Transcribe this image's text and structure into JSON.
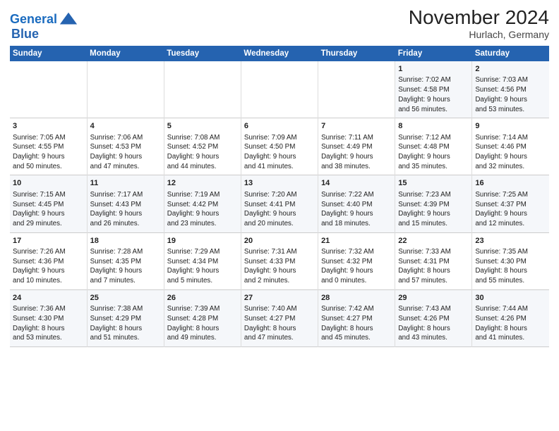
{
  "header": {
    "logo_line1": "General",
    "logo_line2": "Blue",
    "title": "November 2024",
    "location": "Hurlach, Germany"
  },
  "weekdays": [
    "Sunday",
    "Monday",
    "Tuesday",
    "Wednesday",
    "Thursday",
    "Friday",
    "Saturday"
  ],
  "weeks": [
    [
      {
        "day": "",
        "content": ""
      },
      {
        "day": "",
        "content": ""
      },
      {
        "day": "",
        "content": ""
      },
      {
        "day": "",
        "content": ""
      },
      {
        "day": "",
        "content": ""
      },
      {
        "day": "1",
        "content": "Sunrise: 7:02 AM\nSunset: 4:58 PM\nDaylight: 9 hours\nand 56 minutes."
      },
      {
        "day": "2",
        "content": "Sunrise: 7:03 AM\nSunset: 4:56 PM\nDaylight: 9 hours\nand 53 minutes."
      }
    ],
    [
      {
        "day": "3",
        "content": "Sunrise: 7:05 AM\nSunset: 4:55 PM\nDaylight: 9 hours\nand 50 minutes."
      },
      {
        "day": "4",
        "content": "Sunrise: 7:06 AM\nSunset: 4:53 PM\nDaylight: 9 hours\nand 47 minutes."
      },
      {
        "day": "5",
        "content": "Sunrise: 7:08 AM\nSunset: 4:52 PM\nDaylight: 9 hours\nand 44 minutes."
      },
      {
        "day": "6",
        "content": "Sunrise: 7:09 AM\nSunset: 4:50 PM\nDaylight: 9 hours\nand 41 minutes."
      },
      {
        "day": "7",
        "content": "Sunrise: 7:11 AM\nSunset: 4:49 PM\nDaylight: 9 hours\nand 38 minutes."
      },
      {
        "day": "8",
        "content": "Sunrise: 7:12 AM\nSunset: 4:48 PM\nDaylight: 9 hours\nand 35 minutes."
      },
      {
        "day": "9",
        "content": "Sunrise: 7:14 AM\nSunset: 4:46 PM\nDaylight: 9 hours\nand 32 minutes."
      }
    ],
    [
      {
        "day": "10",
        "content": "Sunrise: 7:15 AM\nSunset: 4:45 PM\nDaylight: 9 hours\nand 29 minutes."
      },
      {
        "day": "11",
        "content": "Sunrise: 7:17 AM\nSunset: 4:43 PM\nDaylight: 9 hours\nand 26 minutes."
      },
      {
        "day": "12",
        "content": "Sunrise: 7:19 AM\nSunset: 4:42 PM\nDaylight: 9 hours\nand 23 minutes."
      },
      {
        "day": "13",
        "content": "Sunrise: 7:20 AM\nSunset: 4:41 PM\nDaylight: 9 hours\nand 20 minutes."
      },
      {
        "day": "14",
        "content": "Sunrise: 7:22 AM\nSunset: 4:40 PM\nDaylight: 9 hours\nand 18 minutes."
      },
      {
        "day": "15",
        "content": "Sunrise: 7:23 AM\nSunset: 4:39 PM\nDaylight: 9 hours\nand 15 minutes."
      },
      {
        "day": "16",
        "content": "Sunrise: 7:25 AM\nSunset: 4:37 PM\nDaylight: 9 hours\nand 12 minutes."
      }
    ],
    [
      {
        "day": "17",
        "content": "Sunrise: 7:26 AM\nSunset: 4:36 PM\nDaylight: 9 hours\nand 10 minutes."
      },
      {
        "day": "18",
        "content": "Sunrise: 7:28 AM\nSunset: 4:35 PM\nDaylight: 9 hours\nand 7 minutes."
      },
      {
        "day": "19",
        "content": "Sunrise: 7:29 AM\nSunset: 4:34 PM\nDaylight: 9 hours\nand 5 minutes."
      },
      {
        "day": "20",
        "content": "Sunrise: 7:31 AM\nSunset: 4:33 PM\nDaylight: 9 hours\nand 2 minutes."
      },
      {
        "day": "21",
        "content": "Sunrise: 7:32 AM\nSunset: 4:32 PM\nDaylight: 9 hours\nand 0 minutes."
      },
      {
        "day": "22",
        "content": "Sunrise: 7:33 AM\nSunset: 4:31 PM\nDaylight: 8 hours\nand 57 minutes."
      },
      {
        "day": "23",
        "content": "Sunrise: 7:35 AM\nSunset: 4:30 PM\nDaylight: 8 hours\nand 55 minutes."
      }
    ],
    [
      {
        "day": "24",
        "content": "Sunrise: 7:36 AM\nSunset: 4:30 PM\nDaylight: 8 hours\nand 53 minutes."
      },
      {
        "day": "25",
        "content": "Sunrise: 7:38 AM\nSunset: 4:29 PM\nDaylight: 8 hours\nand 51 minutes."
      },
      {
        "day": "26",
        "content": "Sunrise: 7:39 AM\nSunset: 4:28 PM\nDaylight: 8 hours\nand 49 minutes."
      },
      {
        "day": "27",
        "content": "Sunrise: 7:40 AM\nSunset: 4:27 PM\nDaylight: 8 hours\nand 47 minutes."
      },
      {
        "day": "28",
        "content": "Sunrise: 7:42 AM\nSunset: 4:27 PM\nDaylight: 8 hours\nand 45 minutes."
      },
      {
        "day": "29",
        "content": "Sunrise: 7:43 AM\nSunset: 4:26 PM\nDaylight: 8 hours\nand 43 minutes."
      },
      {
        "day": "30",
        "content": "Sunrise: 7:44 AM\nSunset: 4:26 PM\nDaylight: 8 hours\nand 41 minutes."
      }
    ]
  ]
}
